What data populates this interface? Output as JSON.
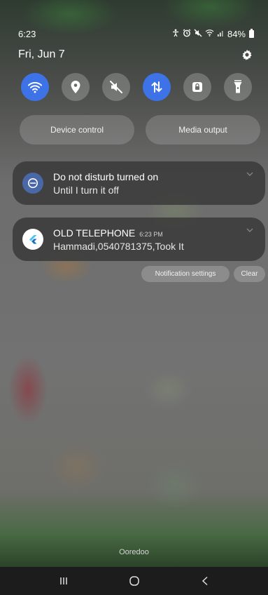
{
  "status_bar": {
    "time": "6:23",
    "battery": "84%",
    "icons": [
      "accessibility-icon",
      "alarm-icon",
      "mute-icon",
      "wifi-icon",
      "signal-icon",
      "battery-icon"
    ]
  },
  "header": {
    "date": "Fri, Jun 7",
    "settings_icon": "gear-icon"
  },
  "quick_toggles": [
    {
      "name": "wifi",
      "icon": "wifi-icon",
      "on": true
    },
    {
      "name": "location",
      "icon": "location-icon",
      "on": false
    },
    {
      "name": "sound",
      "icon": "mute-icon",
      "on": false
    },
    {
      "name": "mobile-data",
      "icon": "data-transfer-icon",
      "on": true
    },
    {
      "name": "lock",
      "icon": "lock-icon",
      "on": false
    },
    {
      "name": "flashlight",
      "icon": "flashlight-icon",
      "on": false
    }
  ],
  "buttons": {
    "device_control": "Device control",
    "media_output": "Media output"
  },
  "notifications": [
    {
      "icon": "do-not-disturb-icon",
      "title": "Do not disturb turned on",
      "body": "Until I turn it off"
    },
    {
      "icon": "flutter-app-icon",
      "title": "OLD TELEPHONE",
      "time": "6:23 PM",
      "body": "Hammadi,0540781375,Took It"
    }
  ],
  "notification_actions": {
    "settings": "Notification settings",
    "clear": "Clear"
  },
  "carrier": "Ooredoo",
  "colors": {
    "accent": "#3d73e6",
    "dnd_icon": "#4a68a8",
    "nav_bar": "#1c1c1c"
  }
}
